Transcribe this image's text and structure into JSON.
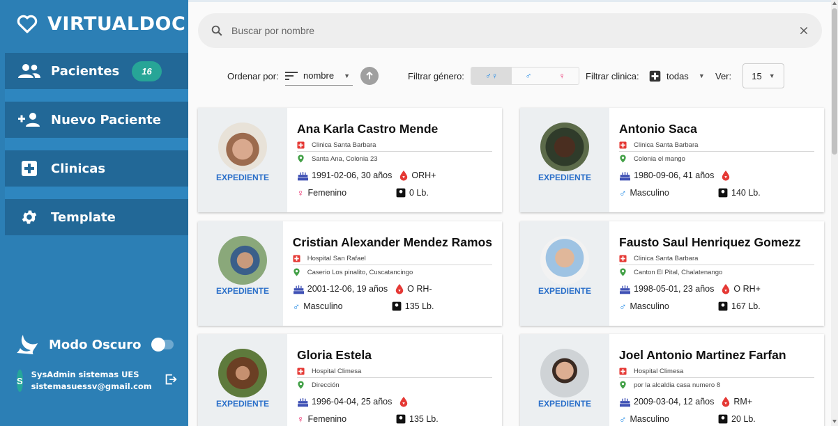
{
  "app": {
    "brand": "VIRTUALDOC"
  },
  "sidebar": {
    "items": [
      {
        "label": "Pacientes",
        "badge": "16",
        "icon": "users-icon"
      },
      {
        "label": "Nuevo Paciente",
        "icon": "add-user-icon"
      },
      {
        "label": "Clinicas",
        "icon": "hospital-plus-icon"
      },
      {
        "label": "Template",
        "icon": "gear-icon"
      }
    ],
    "dark_mode_label": "Modo Oscuro",
    "user": {
      "initial": "S",
      "name": "SysAdmin sistemas UES",
      "email": "sistemasuessv@gmail.com"
    }
  },
  "search": {
    "placeholder": "Buscar por nombre"
  },
  "filters": {
    "sort_label": "Ordenar por:",
    "sort_value": "nombre",
    "gender_label": "Filtrar género:",
    "gender_options": [
      "♂♀",
      "♂",
      "♀"
    ],
    "clinic_label": "Filtrar clinica:",
    "clinic_value": "todas",
    "view_label": "Ver:",
    "view_value": "15"
  },
  "colors": {
    "sidebar": "#2c7fb5",
    "sidebar_item": "#226897",
    "badge": "#27a597",
    "link": "#2a6fc9",
    "clinic_icon": "#e53935",
    "location_icon": "#43a047",
    "blood_icon": "#e53935",
    "cake_icon": "#3f51b5",
    "male": "#1e88e5",
    "female": "#e91e63"
  },
  "card_action": "EXPEDIENTE",
  "patients": [
    {
      "name": "Ana Karla Castro Mende",
      "clinic": "Clinica Santa Barbara",
      "address": "Santa Ana, Colonia 23",
      "birth": "1991-02-06, 30 años",
      "blood": "ORH+",
      "gender": "Femenino",
      "gender_symbol": "♀",
      "weight": "0 Lb."
    },
    {
      "name": "Antonio Saca",
      "clinic": "Clinica Santa Barbara",
      "address": "Colonia el mango",
      "birth": "1980-09-06, 41 años",
      "blood": "",
      "gender": "Masculino",
      "gender_symbol": "♂",
      "weight": "140 Lb."
    },
    {
      "name": "Cristian Alexander Mendez Ramos",
      "clinic": "Hospital San Rafael",
      "address": "Caserio Los pinalito, Cuscatancingo",
      "birth": "2001-12-06, 19 años",
      "blood": "O RH-",
      "gender": "Masculino",
      "gender_symbol": "♂",
      "weight": "135 Lb."
    },
    {
      "name": "Fausto Saul Henriquez Gomezz",
      "clinic": "Clinica Santa Barbara",
      "address": "Canton El Pital, Chalatenango",
      "birth": "1998-05-01, 23 años",
      "blood": "O RH+",
      "gender": "Masculino",
      "gender_symbol": "♂",
      "weight": "167 Lb."
    },
    {
      "name": "Gloria Estela",
      "clinic": "Hospital Climesa",
      "address": "Dirección",
      "birth": "1996-04-04, 25 años",
      "blood": "",
      "gender": "Femenino",
      "gender_symbol": "♀",
      "weight": "135 Lb."
    },
    {
      "name": "Joel Antonio Martinez Farfan",
      "clinic": "Hospital Climesa",
      "address": "por la alcaldia casa numero 8",
      "birth": "2009-03-04, 12 años",
      "blood": "RM+",
      "gender": "Masculino",
      "gender_symbol": "♂",
      "weight": "20 Lb."
    }
  ]
}
